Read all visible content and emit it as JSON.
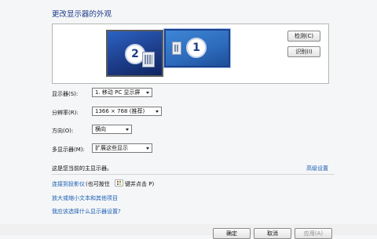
{
  "title": "更改显示器的外观",
  "monitors": [
    {
      "number": "2"
    },
    {
      "number": "1"
    }
  ],
  "buttons": {
    "detect": "检测(C)",
    "identify": "识别(I)",
    "ok": "确定",
    "cancel": "取消",
    "apply": "应用(A)"
  },
  "settings": {
    "display_label": "显示器(S):",
    "display_value": "1. 移动 PC 显示屏",
    "resolution_label": "分辨率(R):",
    "resolution_value": "1366 × 768 (推荐)",
    "orientation_label": "方向(O):",
    "orientation_value": "横向",
    "multi_label": "多显示器(M):",
    "multi_value": "扩展这些显示"
  },
  "status": {
    "main_display": "这是您当前的主显示器。",
    "advanced": "高级设置"
  },
  "links": {
    "projector": "连接到投影仪",
    "projector_hint": "(也可按住",
    "projector_hint2": "键并点击 P)",
    "text_size": "放大或缩小文本和其他项目",
    "which_display": "我应该选择什么显示器设置?"
  }
}
